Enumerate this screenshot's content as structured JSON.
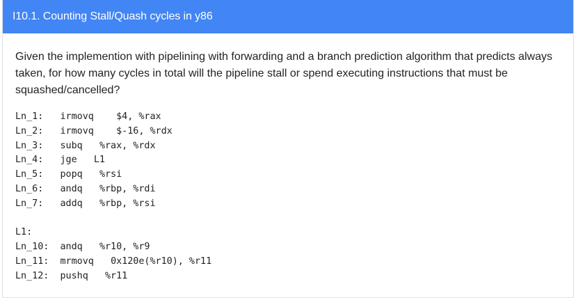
{
  "card": {
    "title": "I10.1. Counting Stall/Quash cycles in y86"
  },
  "question": {
    "text": "Given the implemention with pipelining with forwarding and a branch prediction algorithm that predicts always taken, for how many cycles in total will the pipeline stall or spend executing instructions that must be squashed/cancelled?"
  },
  "code": {
    "lines": [
      {
        "label": "Ln_1:",
        "op": "irmovq",
        "args": "$4, %rax"
      },
      {
        "label": "Ln_2:",
        "op": "irmovq",
        "args": "$-16, %rdx"
      },
      {
        "label": "Ln_3:",
        "op": "subq",
        "args": "%rax, %rdx"
      },
      {
        "label": "Ln_4:",
        "op": "jge",
        "args": "L1"
      },
      {
        "label": "Ln_5:",
        "op": "popq",
        "args": "%rsi"
      },
      {
        "label": "Ln_6:",
        "op": "andq",
        "args": "%rbp, %rdi"
      },
      {
        "label": "Ln_7:",
        "op": "addq",
        "args": "%rbp, %rsi"
      }
    ],
    "section_label": "L1:",
    "lines2": [
      {
        "label": "Ln_10:",
        "op": "andq",
        "args": "%r10, %r9"
      },
      {
        "label": "Ln_11:",
        "op": "mrmovq",
        "args": "0x120e(%r10), %r11"
      },
      {
        "label": "Ln_12:",
        "op": "pushq",
        "args": "%r11"
      }
    ]
  },
  "colors": {
    "header_bg": "#4285f4",
    "header_text": "#ffffff",
    "body_text": "#222222"
  }
}
